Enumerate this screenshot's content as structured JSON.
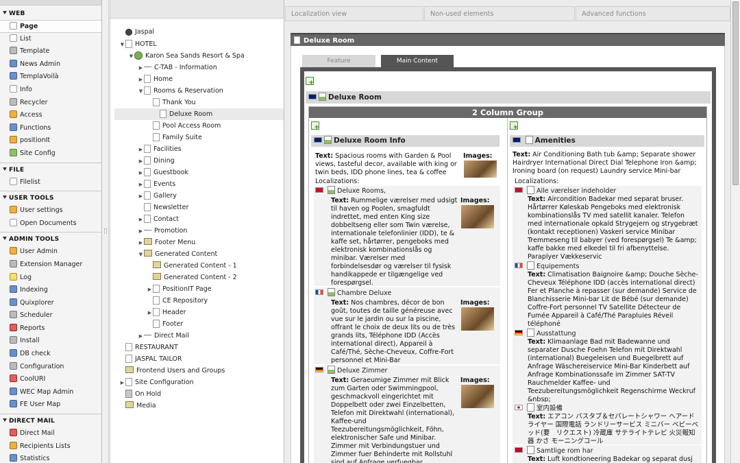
{
  "menu": {
    "web": "WEB",
    "file": "FILE",
    "usertools": "USER TOOLS",
    "admintools": "ADMIN TOOLS",
    "directmail": "DIRECT MAIL",
    "web_items": [
      "Page",
      "List",
      "Template",
      "News Admin",
      "TemplaVoilà",
      "Info",
      "Recycler",
      "Access",
      "Functions",
      "positionIt",
      "Site Config"
    ],
    "file_items": [
      "Filelist"
    ],
    "user_items": [
      "User settings",
      "Open Documents"
    ],
    "admin_items": [
      "User Admin",
      "Extension Manager",
      "Log",
      "Indexing",
      "Quixplorer",
      "Scheduler",
      "Reports",
      "Install",
      "DB check",
      "Configuration",
      "CoolURI",
      "WEC Map Admin",
      "FE User Map"
    ],
    "dm_items": [
      "Direct Mail",
      "Recipients Lists",
      "Statistics"
    ]
  },
  "tree": [
    "Jaspal",
    "HOTEL",
    "Karon Sea Sands Resort & Spa",
    "C-TAB - Information",
    "Home",
    "Rooms & Reservation",
    "Thank You",
    "Deluxe Room",
    "Pool Access Room",
    "Family Suite",
    "Facilities",
    "Dining",
    "Guestbook",
    "Events",
    "Gallery",
    "Newsletter",
    "Contact",
    "Promotion",
    "Footer Menu",
    "Generated Content",
    "Generated Content - 1",
    "Generated Content - 2",
    "PositionIT Page",
    "CE Repository",
    "Header",
    "Footer",
    "Direct Mail",
    "RESTAURANT",
    "JASPAL TAILOR",
    "Frontend Users and Groups",
    "Site Configuration",
    "On Hold",
    "Media"
  ],
  "tabs": {
    "t1": "Localization view",
    "t2": "Non-used elements",
    "t3": "Advanced functions"
  },
  "page_title": "Deluxe Room",
  "subtabs": {
    "feature": "Feature",
    "main": "Main Content"
  },
  "fce_title": "Deluxe Room",
  "group_title": "2 Column Group",
  "left": {
    "title": "Deluxe Room Info",
    "text_label": "Text:",
    "images_label": "Images:",
    "text": "Spacious rooms with Garden & Pool views, tasteful decor, available with king or twin beds, IDD phone lines, tea & coffee",
    "loc_label": "Localizations:",
    "locs": [
      {
        "title": "Deluxe Rooms,",
        "text": "Rummelige værelser med udsigt til haven og Poolen, smagfuldt indrettet, med enten King size dobbeltseng eller som Twin værelse, internationale telefonlinier (IDD), te & kaffe set, hårtørrer, pengeboks  med elektronisk kombinationslås og minibar. Værelser med forbindelsesdør og værelser til fysisk handikappede er tilgængelige ved forespørgsel."
      },
      {
        "title": "Chambre Deluxe",
        "text": "Nos chambres, décor de bon goût,  toutes de taille généreuse avec vue sur le jardin ou sur la piscine, offrant le choix de deux lits ou de très grands lits, Téléphone IDD (Accès international direct), Appareil à Café/Thé, Sèche-Cheveux, Coffre-Fort personnel et Mini-Bar"
      },
      {
        "title": "Deluxe Zimmer",
        "text": "Geraeumige Zimmer mit Blick zum Garten oder Swimmingpool, geschmackvoll eingerichtet mit Doppelbett oder zwei Einzelbetten, Telefon mit Direktwahl (international), Kaffee-und Teezubereitungsmöglichkeit, Föhn, elektronischer Safe und Minibar. Zimmer mit Verbindungstuer und Zimmer fuer Behinderte mit Rollstuhl sind auf Anfrage verfuegbar."
      }
    ]
  },
  "right": {
    "title": "Amenities",
    "text_label": "Text:",
    "text": "Air Conditioning Bath tub &amp; Separate shower Hairdryer International Direct Dial Telephone Iron &amp; Ironing board (on request) Laundry service Mini-bar",
    "loc_label": "Localizations:",
    "locs": [
      {
        "title": "Alle værelser indeholder",
        "text": "Aircondition Badekar med separat bruser. Hårtørrer Køleskab Pengeboks med elektronisk kombinationslås TV med satellit kanaler. Telefon med internationale opkald Strygejern og strygebræt (kontakt receptionen) Vaskeri service Minibar Tremmeseng til babyer (ved forespørgsel) Te &amp; kaffe bakke med elkedel til fri afbenyttelse. Paraplyer Vækkeservic"
      },
      {
        "title": "Equipements",
        "text": "Climatisation Baignoire &amp; Douche Sèche-Cheveux Téléphone IDD (accès international direct) Fer et Planche à repasser (sur demande) Service de Blanchisserie Mini-bar Lit de Bébé (sur demande) Coffre-Fort personnel TV Satellite Détecteur de Fumée Appareil à Café/Thé Parapluies Réveil téléphoné"
      },
      {
        "title": "Ausstattung",
        "text": "Klimaanlage Bad mit Badewanne und separater Dusche Foehn Telefon mit Direktwahl (international) Buegeleisen und Buegelbrett auf Anfrage Wäschereiservice Mini-Bar Kinderbett auf Anfrage Kombinationssafe im Zimmer SAT-TV Rauchmelder Kaffee- und Teezubereitungsmöglichkeit Regenschirme Weckruf &nbsp;"
      },
      {
        "title": "室内設備",
        "text": "エアコン バスタブ＆セパレートシャワー ヘアードライヤー 国際電話 ランドリーサービス ミニバー ベビーベッド(要　リクエスト) 冷蔵庫 サテライトテレビ 火災報知器 かさ モーニングコール"
      },
      {
        "title": "Samtlige rom har",
        "text": "Luft kondtioneering Badekar og separat dusj"
      }
    ]
  }
}
